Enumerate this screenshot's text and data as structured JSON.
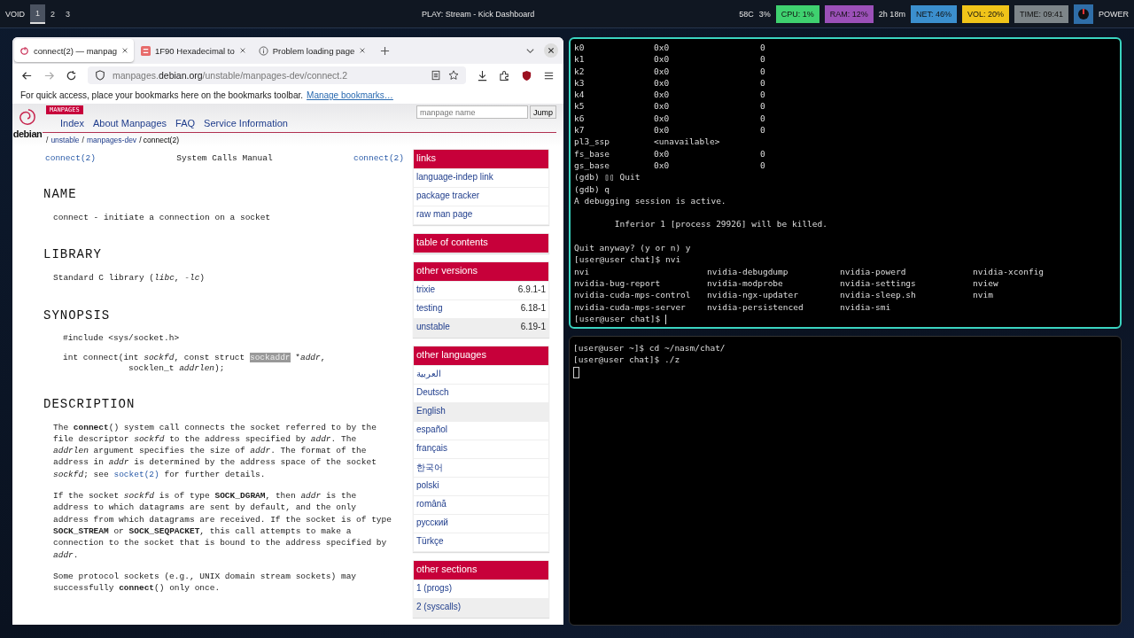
{
  "top_bar": {
    "brand": "VOID",
    "workspaces": [
      {
        "label": "1",
        "selected": true
      },
      {
        "label": "2",
        "selected": false
      },
      {
        "label": "3",
        "selected": false
      }
    ],
    "title": "PLAY: Stream - Kick Dashboard",
    "status": [
      {
        "text": "58C"
      },
      {
        "text": "3%"
      },
      {
        "text": "CPU: 1%",
        "color": "#3fd16f"
      },
      {
        "text": "RAM: 12%",
        "color": "#9b50b8"
      },
      {
        "text": "2h 18m"
      },
      {
        "text": "NET: 46%",
        "color": "#3b8fce"
      },
      {
        "text": "VOL: 20%",
        "color": "#f0c419"
      },
      {
        "text": "TIME: 09:41",
        "color": "#7d8589"
      }
    ],
    "power": "POWER"
  },
  "browser": {
    "tabs": [
      {
        "title": "connect(2) — manpag",
        "selected": true
      },
      {
        "title": "1F90 Hexadecimal to",
        "selected": false
      },
      {
        "title": "Problem loading page",
        "selected": false
      }
    ],
    "url": {
      "prefix": "manpages.",
      "domain": "debian.org",
      "path": "/unstable/manpages-dev/connect.2"
    },
    "bookmarks_hint": "For quick access, place your bookmarks here on the bookmarks toolbar.",
    "bookmarks_link": "Manage bookmarks…",
    "site": {
      "badge": "MANPAGES",
      "logo": "debian",
      "search_placeholder": "manpage name",
      "jump": "Jump",
      "nav": [
        "Index",
        "About Manpages",
        "FAQ",
        "Service Information"
      ],
      "breadcrumb": [
        {
          "sep": "/",
          "label": "unstable"
        },
        {
          "sep": "/",
          "label": "manpages-dev"
        }
      ],
      "current": "/ connect(2)"
    },
    "man": {
      "header": [
        "connect(2)",
        "System Calls Manual",
        "connect(2)"
      ],
      "sections": [
        {
          "title": "NAME",
          "blocks": [
            {
              "kind": "para",
              "parts": [
                {
                  "kind": "text",
                  "t": "connect - initiate a connection on a socket"
                }
              ]
            }
          ]
        },
        {
          "title": "LIBRARY",
          "blocks": [
            {
              "kind": "para",
              "parts": [
                {
                  "kind": "text",
                  "t": "Standard C library (*libc*, *-lc*)"
                }
              ]
            }
          ]
        },
        {
          "title": "SYNOPSIS",
          "blocks": [
            {
              "kind": "code",
              "parts": [
                {
                  "kind": "text",
                  "t": "#include <sys/socket.h>"
                }
              ]
            },
            {
              "kind": "code",
              "parts": [
                {
                  "kind": "text",
                  "t": "int connect(int *sockfd*, const struct "
                },
                {
                  "kind": "selected",
                  "t": "sockaddr"
                },
                {
                  "kind": "text",
                  "t": " *"
                },
                {
                  "kind": "text",
                  "t": "*addr*,"
                }
              ]
            },
            {
              "kind": "code_cont",
              "parts": [
                {
                  "kind": "text",
                  "t": "socklen_t *addrlen*);"
                }
              ]
            }
          ]
        },
        {
          "title": "DESCRIPTION",
          "blocks": [
            {
              "kind": "para",
              "parts": [
                {
                  "kind": "text",
                  "t": "The **connect**() system call connects the socket referred to by the file descriptor *sockfd* to the address specified by *addr*.  The *addrlen* argument specifies the size of *addr*.  The format of the address in *addr* is determined by the address space of the socket *sockfd*; see "
                },
                {
                  "kind": "link",
                  "t": "socket(2)"
                },
                {
                  "kind": "text",
                  "t": " for further details."
                }
              ]
            },
            {
              "kind": "para",
              "parts": [
                {
                  "kind": "text",
                  "t": "If the socket *sockfd* is of type **SOCK_DGRAM**, then *addr* is the address to which datagrams are sent by default, and the only address from which datagrams are received.  If the socket is of type **SOCK_STREAM** or **SOCK_SEQPACKET**, this call attempts to make a connection to the socket that is bound to the address specified by *addr*."
                }
              ]
            },
            {
              "kind": "para",
              "parts": [
                {
                  "kind": "text",
                  "t": "Some protocol sockets (e.g., UNIX domain stream sockets) may successfully **connect**() only once."
                }
              ]
            }
          ]
        }
      ]
    },
    "sidebar": [
      {
        "title": "links",
        "items": [
          {
            "label": "language-indep link",
            "selected": false
          },
          {
            "label": "package tracker",
            "selected": false
          },
          {
            "label": "raw man page",
            "selected": false
          }
        ]
      },
      {
        "title": "table of contents"
      },
      {
        "title": "other versions",
        "items": [
          {
            "label": "trixie",
            "value": "6.9.1-1",
            "selected": false
          },
          {
            "label": "testing",
            "value": "6.18-1",
            "selected": false
          },
          {
            "label": "unstable",
            "value": "6.19-1",
            "selected": true
          }
        ]
      },
      {
        "title": "other languages",
        "items": [
          {
            "label": "العربية",
            "selected": false
          },
          {
            "label": "Deutsch",
            "selected": false
          },
          {
            "label": "English",
            "selected": true
          },
          {
            "label": "español",
            "selected": false
          },
          {
            "label": "français",
            "selected": false
          },
          {
            "label": "한국어",
            "selected": false
          },
          {
            "label": "polski",
            "selected": false
          },
          {
            "label": "română",
            "selected": false
          },
          {
            "label": "русский",
            "selected": false
          },
          {
            "label": "Türkçe",
            "selected": false
          }
        ]
      },
      {
        "title": "other sections",
        "items": [
          {
            "label": "1 (progs)",
            "selected": false
          },
          {
            "label": "2 (syscalls)",
            "selected": true
          }
        ]
      }
    ]
  },
  "terminal_top": {
    "lines": [
      {
        "kind": "reg",
        "cells": [
          "k0",
          "0x0",
          "0"
        ]
      },
      {
        "kind": "reg",
        "cells": [
          "k1",
          "0x0",
          "0"
        ]
      },
      {
        "kind": "reg",
        "cells": [
          "k2",
          "0x0",
          "0"
        ]
      },
      {
        "kind": "reg",
        "cells": [
          "k3",
          "0x0",
          "0"
        ]
      },
      {
        "kind": "reg",
        "cells": [
          "k4",
          "0x0",
          "0"
        ]
      },
      {
        "kind": "reg",
        "cells": [
          "k5",
          "0x0",
          "0"
        ]
      },
      {
        "kind": "reg",
        "cells": [
          "k6",
          "0x0",
          "0"
        ]
      },
      {
        "kind": "reg",
        "cells": [
          "k7",
          "0x0",
          "0"
        ]
      },
      {
        "kind": "reg",
        "cells": [
          "pl3_ssp",
          "<unavailable>"
        ]
      },
      {
        "kind": "reg",
        "cells": [
          "fs_base",
          "0x0",
          "0"
        ]
      },
      {
        "kind": "reg",
        "cells": [
          "gs_base",
          "0x0",
          "0"
        ]
      },
      {
        "kind": "text",
        "text": "(gdb) ▯▯ Quit"
      },
      {
        "kind": "text",
        "text": "(gdb) q"
      },
      {
        "kind": "text",
        "text": "A debugging session is active."
      },
      {
        "kind": "blank"
      },
      {
        "kind": "text",
        "text": "        Inferior 1 [process 29926] will be killed."
      },
      {
        "kind": "blank"
      },
      {
        "kind": "text",
        "text": "Quit anyway? (y or n) y"
      },
      {
        "kind": "text",
        "text": "[user@user chat]$ nvi"
      },
      {
        "kind": "grid",
        "cells": [
          "nvi",
          "nvidia-debugdump",
          "nvidia-powerd",
          "nvidia-xconfig",
          "nvidia-bug-report",
          "nvidia-modprobe",
          "nvidia-settings",
          "nview",
          "nvidia-cuda-mps-control",
          "nvidia-ngx-updater",
          "nvidia-sleep.sh",
          "nvim",
          "nvidia-cuda-mps-server",
          "nvidia-persistenced",
          "nvidia-smi"
        ]
      },
      {
        "kind": "prompt",
        "text": "[user@user chat]$ "
      }
    ]
  },
  "terminal_bottom": {
    "lines": [
      {
        "kind": "text",
        "text": "[user@user ~]$ cd ~/nasm/chat/"
      },
      {
        "kind": "text",
        "text": "[user@user chat]$ ./z"
      },
      {
        "kind": "cursor"
      }
    ]
  }
}
